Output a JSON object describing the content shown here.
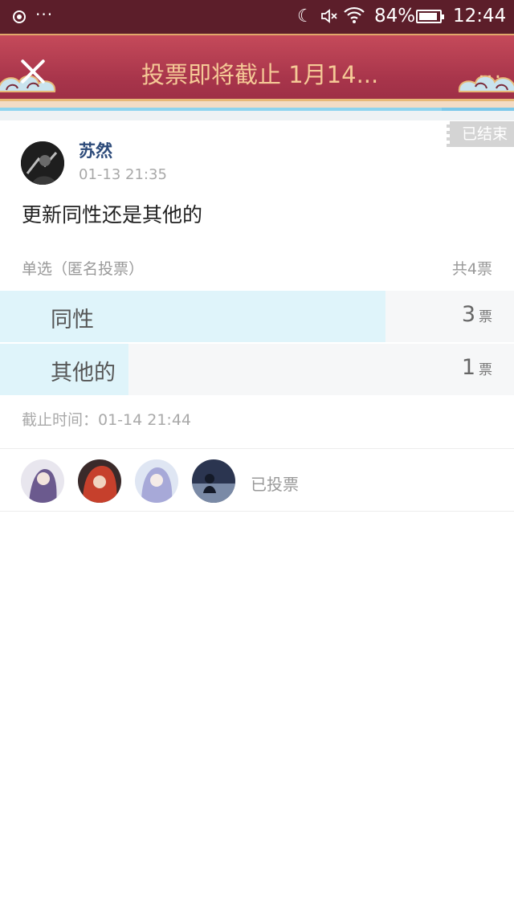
{
  "status_bar": {
    "battery": "84%",
    "time": "12:44"
  },
  "header": {
    "title": "投票即将截止 1月14...",
    "more": "..."
  },
  "poll": {
    "ended_tag": "已结束",
    "author": "苏然",
    "post_time": "01-13 21:35",
    "content": "更新同性还是其他的",
    "vote_type": "单选（匿名投票）",
    "total_votes": "共4票",
    "options": [
      {
        "label": "同性",
        "count": "3",
        "unit": "票",
        "fraction": 0.75
      },
      {
        "label": "其他的",
        "count": "1",
        "unit": "票",
        "fraction": 0.25
      }
    ],
    "deadline": "截止时间：01-14 21:44",
    "voters_label": "已投票",
    "voter_avatars": [
      "purple-hair-avatar",
      "red-hair-avatar",
      "lavender-hair-avatar",
      "night-scene-avatar"
    ]
  },
  "colors": {
    "status_bar_bg": "#5c1e2a",
    "header_bg": "#a8354b",
    "header_title": "#f5c996",
    "option_fill": "#dff4fa",
    "author_name": "#2d4b7a"
  }
}
